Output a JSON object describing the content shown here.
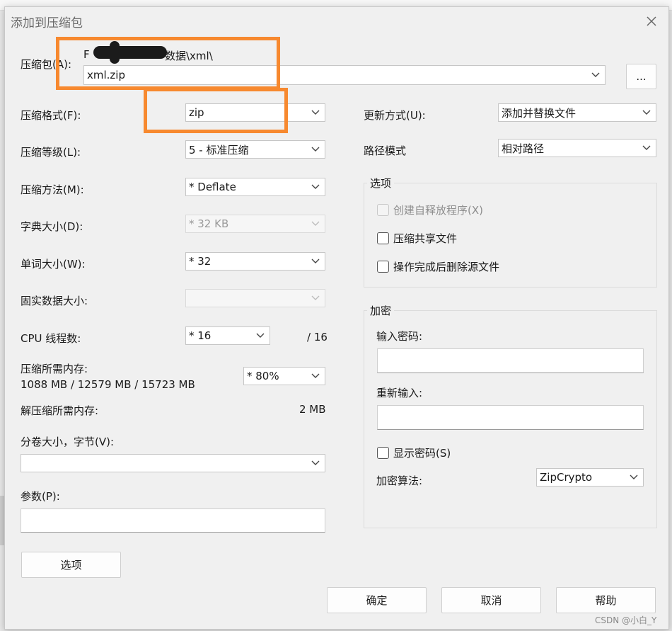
{
  "dialog": {
    "title": "添加到压缩包",
    "close_glyph": "✕"
  },
  "archive": {
    "label": "压缩包(A):",
    "path_prefix": "F",
    "path_suffix": "数据\\xml\\",
    "filename": "xml.zip",
    "browse_label": "..."
  },
  "left": {
    "format_label": "压缩格式(F):",
    "format_value": "zip",
    "level_label": "压缩等级(L):",
    "level_value": "5 - 标准压缩",
    "method_label": "压缩方法(M):",
    "method_value": "*  Deflate",
    "dict_label": "字典大小(D):",
    "dict_value": "*  32 KB",
    "word_label": "单词大小(W):",
    "word_value": "*  32",
    "solid_label": "固实数据大小:",
    "solid_value": "",
    "cpu_label": "CPU 线程数:",
    "cpu_value": "*  16",
    "cpu_max": "/ 16",
    "mem_label": "压缩所需内存:",
    "mem_value": "1088 MB / 12579 MB / 15723 MB",
    "mem_percent": "*  80%",
    "decomp_label": "解压缩所需内存:",
    "decomp_value": "2 MB",
    "volume_label": "分卷大小，字节(V):",
    "volume_value": "",
    "params_label": "参数(P):",
    "options_button": "选项"
  },
  "right": {
    "update_label": "更新方式(U):",
    "update_value": "添加并替换文件",
    "path_mode_label": "路径模式",
    "path_mode_value": "相对路径",
    "options_group": "选项",
    "opt_sfx": "创建自释放程序(X)",
    "opt_shared": "压缩共享文件",
    "opt_delete": "操作完成后删除源文件",
    "encrypt_group": "加密",
    "pwd_label": "输入密码:",
    "pwd_again_label": "重新输入:",
    "show_pwd": "显示密码(S)",
    "algo_label": "加密算法:",
    "algo_value": "ZipCrypto"
  },
  "footer": {
    "ok": "确定",
    "cancel": "取消",
    "help": "帮助"
  },
  "watermark": "CSDN @小白_Y",
  "colors": {
    "highlight": "#f7892f",
    "dialog_bg": "#f0f0f0"
  }
}
